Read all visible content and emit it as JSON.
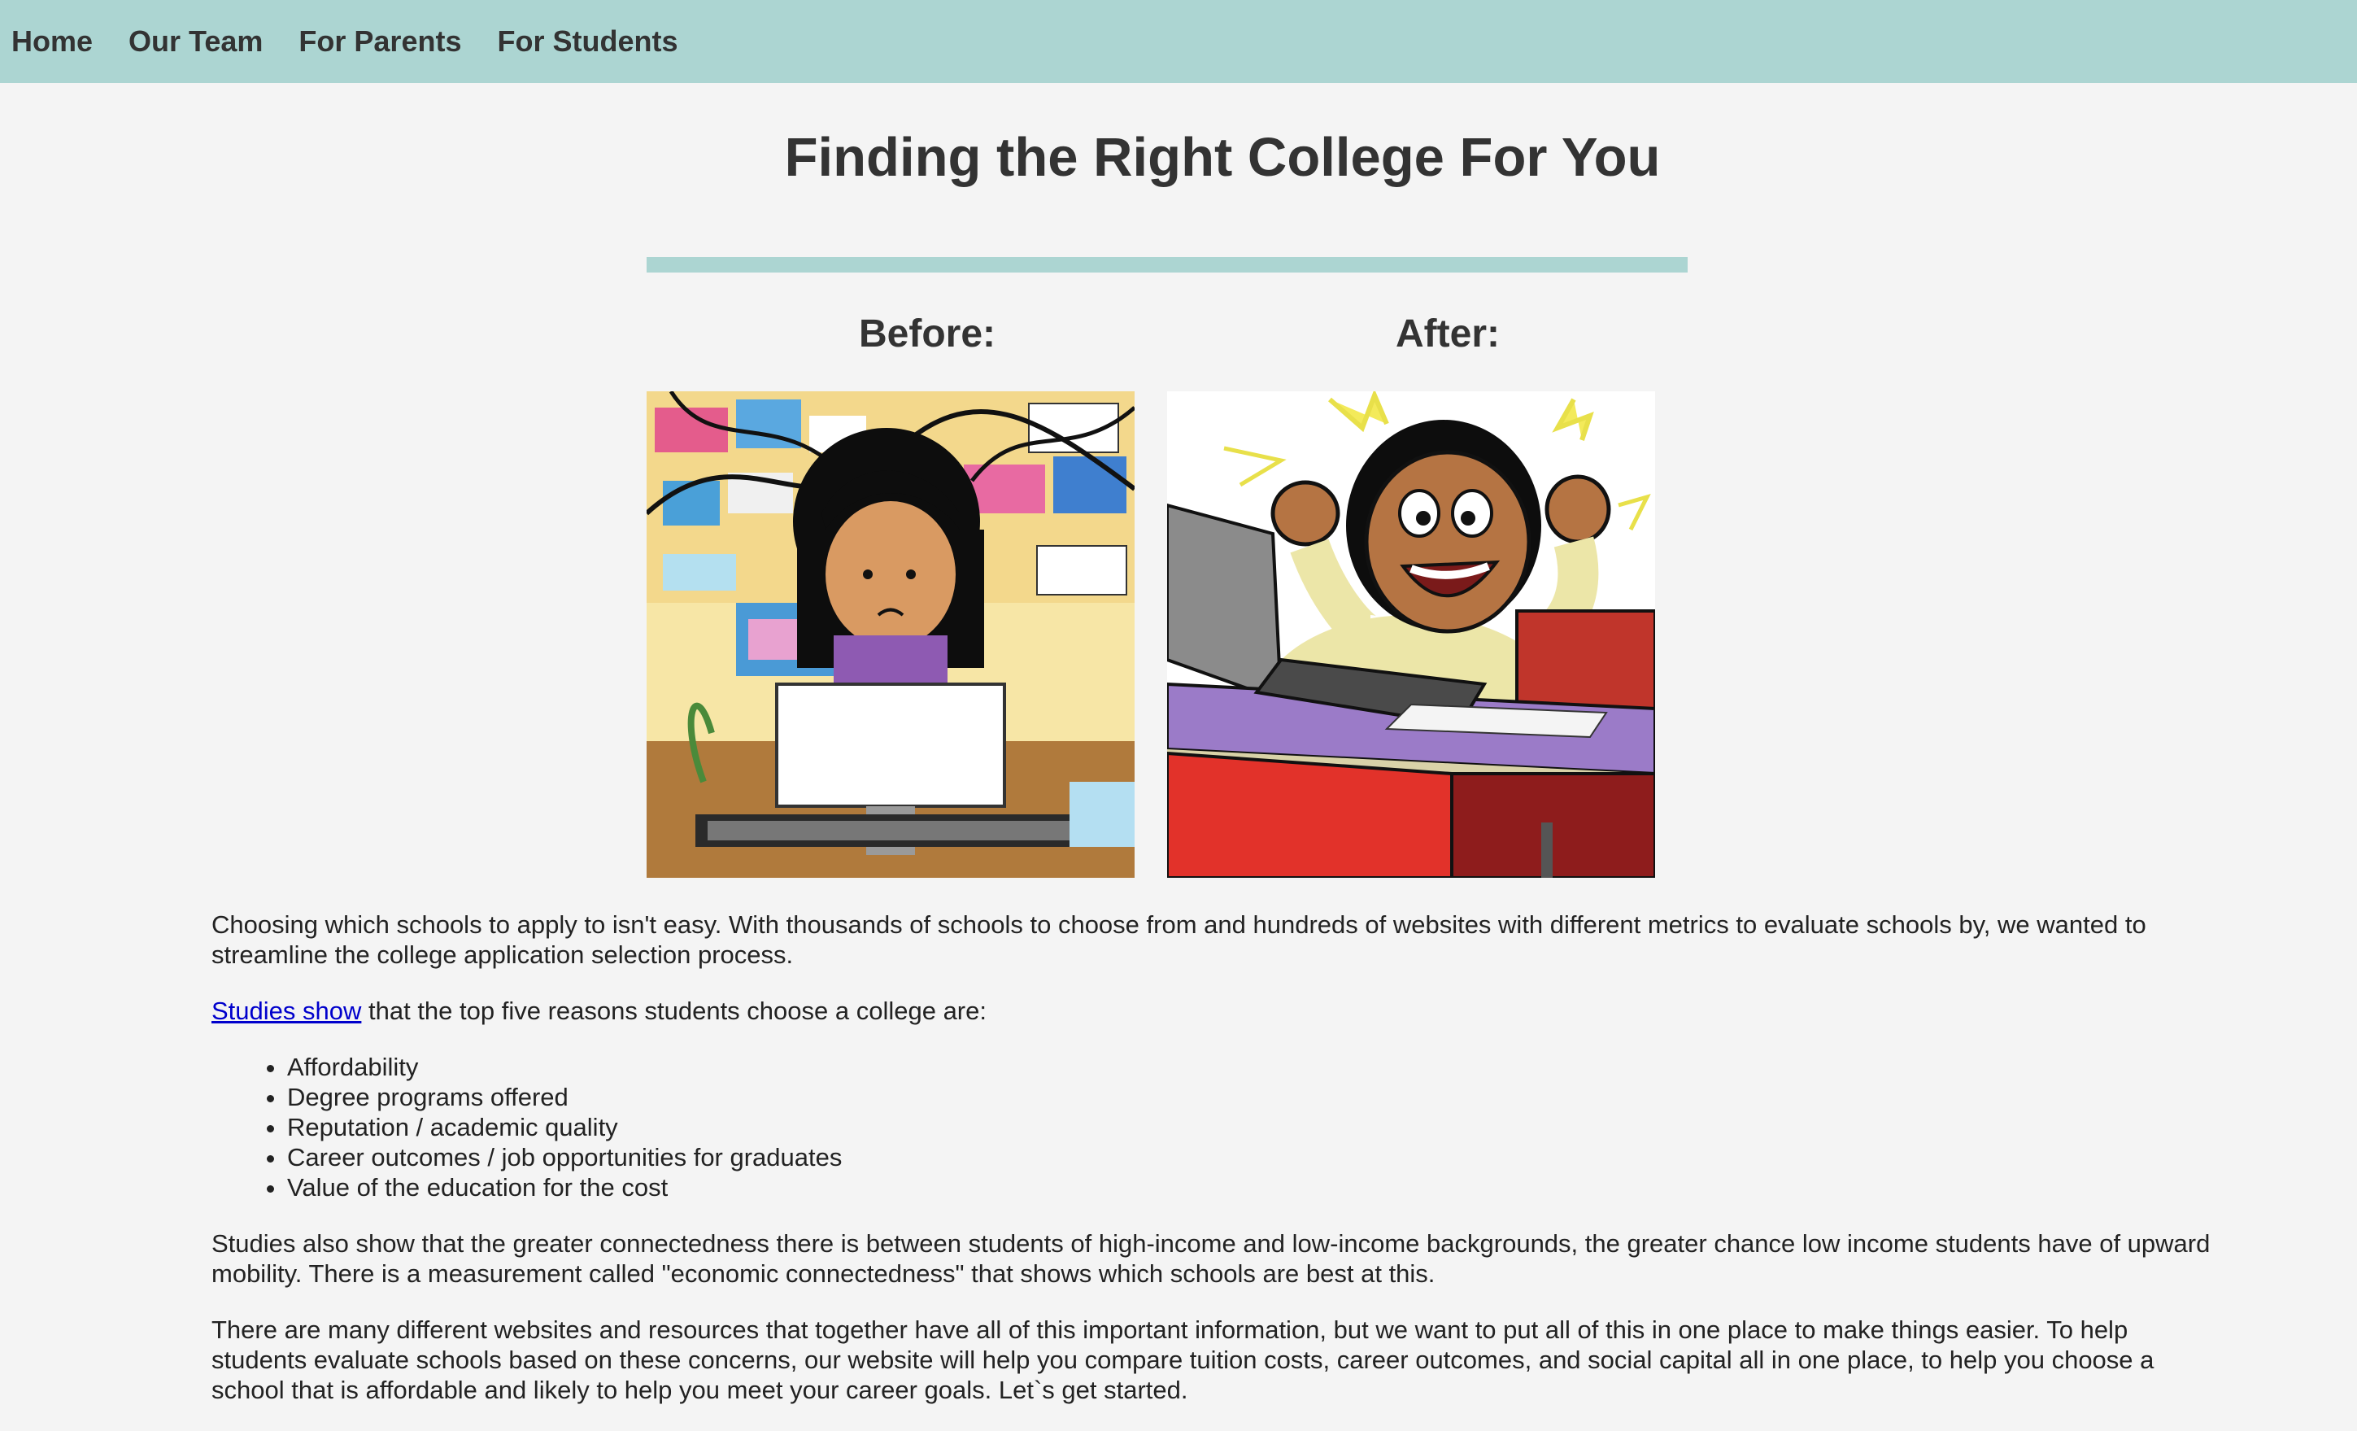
{
  "nav": {
    "items": [
      {
        "label": "Home"
      },
      {
        "label": "Our Team"
      },
      {
        "label": "For Parents"
      },
      {
        "label": "For Students"
      }
    ],
    "background": "#acd5d2"
  },
  "page": {
    "title": "Finding the Right College For You",
    "before_label": "Before:",
    "after_label": "After:",
    "before_image": "stressed-student-illustration",
    "after_image": "happy-student-illustration"
  },
  "content": {
    "intro": "Choosing which schools to apply to isn't easy. With thousands of schools to choose from and hundreds of websites with different metrics to evaluate schools by, we wanted to streamline the college application selection process.",
    "studies_link": "Studies show",
    "studies_text": " that the top five reasons students choose a college are:",
    "reasons": [
      "Affordability",
      "Degree programs offered",
      "Reputation / academic quality",
      "Career outcomes / job opportunities for graduates",
      "Value of the education for the cost"
    ],
    "connectedness": "Studies also show that the greater connectedness there is between students of high-income and low-income backgrounds, the greater chance low income students have of upward mobility. There is a measurement called \"economic connectedness\" that shows which schools are best at this.",
    "closing": "There are many different websites and resources that together have all of this important information, but we want to put all of this in one place to make things easier. To help students evaluate schools based on these concerns, our website will help you compare tuition costs, career outcomes, and social capital all in one place, to help you choose a school that is affordable and likely to help you meet your career goals. Let`s get started."
  },
  "colors": {
    "accent": "#acd5d2",
    "background": "#f4f4f4",
    "link": "#0000cc"
  }
}
